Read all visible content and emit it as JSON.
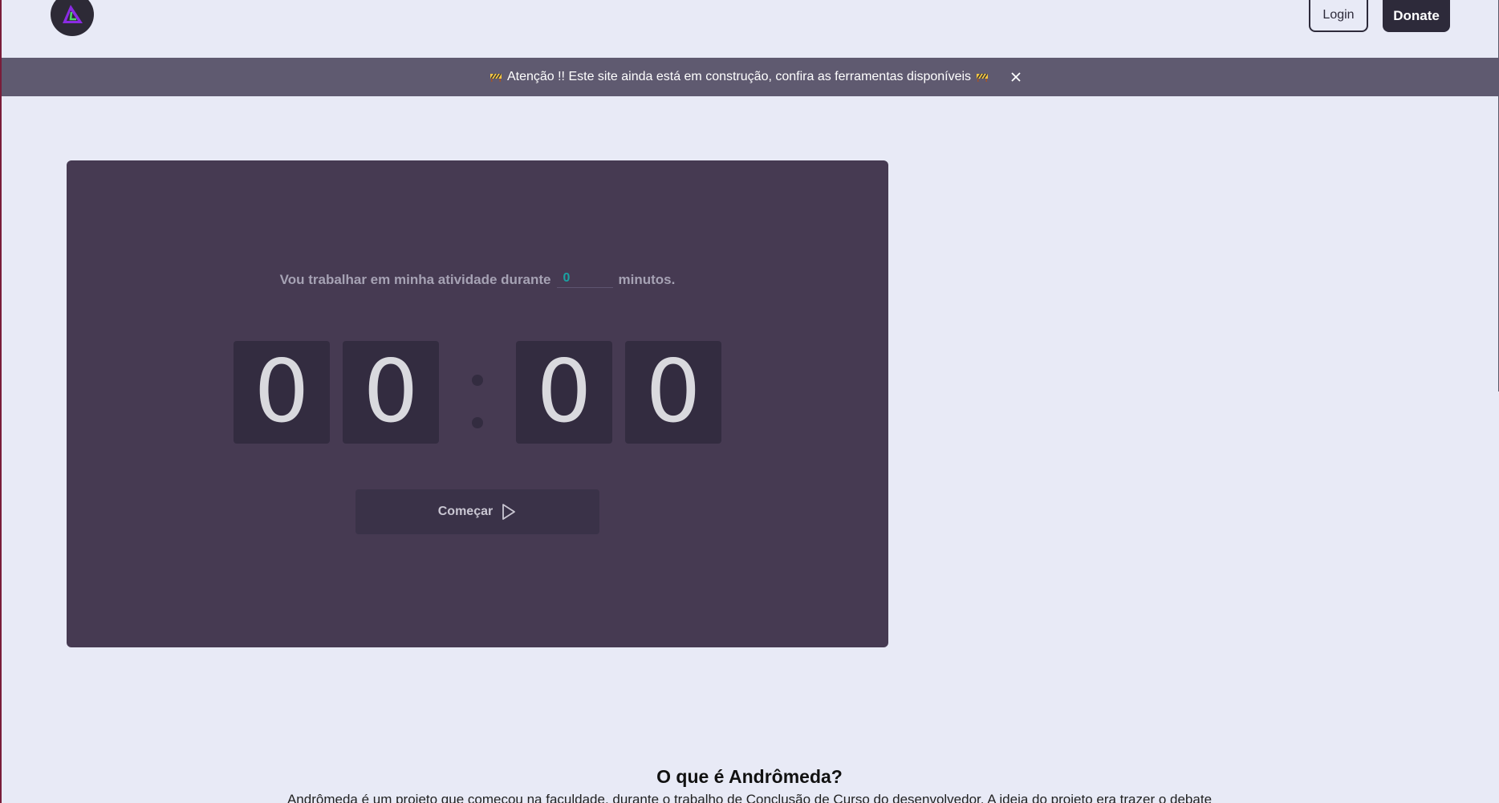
{
  "header": {
    "logo_icon": "andromeda-triangle-logo",
    "login_label": "Login",
    "donate_label": "Donate"
  },
  "banner": {
    "text": "Atenção !! Este site ainda está em construção, confira as ferramentas disponíveis",
    "emoji_icon": "construction-sign-icon",
    "close_icon": "close-icon"
  },
  "timer": {
    "prefix": "Vou trabalhar em minha atividade durante",
    "minutes_value": "0",
    "suffix": "minutos.",
    "digits": [
      "0",
      "0",
      "0",
      "0"
    ],
    "start_label": "Começar",
    "start_icon": "play-icon"
  },
  "about": {
    "title": "O que é Andrômeda?",
    "text": "Andrômeda é um projeto que começou na faculdade, durante o trabalho de Conclusão de Curso do desenvolvedor. A ideia do projeto era trazer o debate"
  },
  "colors": {
    "page_bg": "#e8eaf6",
    "banner_bg": "#5f5a70",
    "card_bg": "#463a52",
    "digit_bg": "#332c40",
    "accent": "#1aa3a3",
    "dark_button": "#2d2a3a"
  }
}
